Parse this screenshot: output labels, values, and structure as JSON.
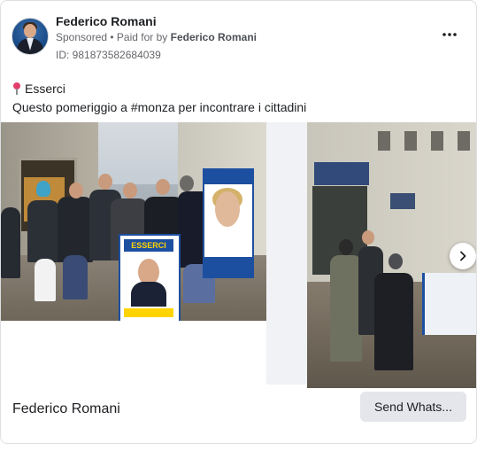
{
  "post": {
    "author": "Federico Romani",
    "sponsored": "Sponsored",
    "paid_for_prefix": "• Paid for by",
    "paid_for_name": "Federico Romani",
    "ad_id": "ID: 981873582684039",
    "emoji_label": "pin-emoji",
    "text_line1": "Esserci",
    "text_line2": "Questo pomeriggio a #monza per incontrare i cittadini"
  },
  "carousel": {
    "card1": {
      "poster_title": "ESSERCI",
      "footer_name": "Federico Romani",
      "cta_label": "Send Whats..."
    }
  },
  "icons": {
    "more": "more-horizontal-icon",
    "next": "chevron-right-icon"
  },
  "colors": {
    "brand_blue": "#1d4fa0",
    "poster_yellow": "#ffd400",
    "cta_bg": "#e4e6eb"
  }
}
